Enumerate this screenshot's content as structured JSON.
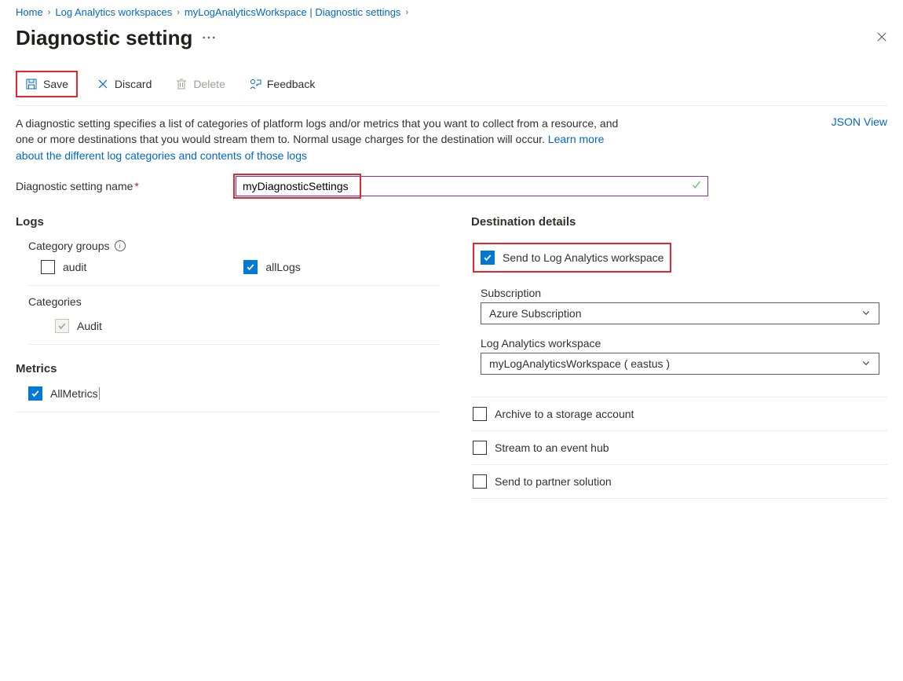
{
  "breadcrumbs": {
    "home": "Home",
    "workspaces": "Log Analytics workspaces",
    "current": "myLogAnalyticsWorkspace | Diagnostic settings"
  },
  "title": "Diagnostic setting",
  "toolbar": {
    "save": "Save",
    "discard": "Discard",
    "delete": "Delete",
    "feedback": "Feedback"
  },
  "desc": {
    "text1": "A diagnostic setting specifies a list of categories of platform logs and/or metrics that you want to collect from a resource, and one or more destinations that you would stream them to. Normal usage charges for the destination will occur. ",
    "link": "Learn more about the different log categories and contents of those logs"
  },
  "json_view": "JSON View",
  "name": {
    "label": "Diagnostic setting name",
    "value": "myDiagnosticSettings"
  },
  "logs": {
    "heading": "Logs",
    "category_groups_label": "Category groups",
    "audit": "audit",
    "allLogs": "allLogs",
    "categories_label": "Categories",
    "audit_cat": "Audit"
  },
  "metrics": {
    "heading": "Metrics",
    "all": "AllMetrics"
  },
  "dest": {
    "heading": "Destination details",
    "send_law": "Send to Log Analytics workspace",
    "sub_label": "Subscription",
    "sub_value": "Azure Subscription",
    "law_label": "Log Analytics workspace",
    "law_value": "myLogAnalyticsWorkspace ( eastus )",
    "archive": "Archive to a storage account",
    "stream": "Stream to an event hub",
    "partner": "Send to partner solution"
  }
}
